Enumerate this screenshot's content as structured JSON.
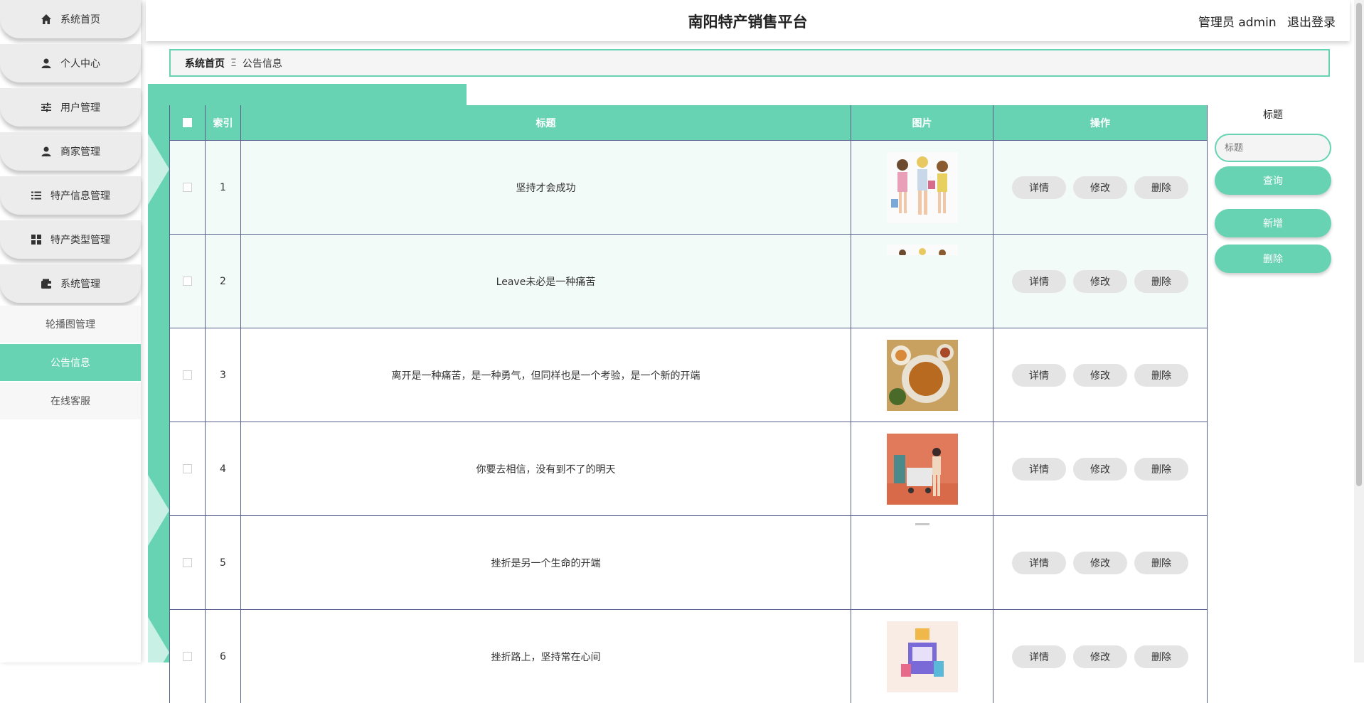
{
  "header": {
    "title": "南阳特产销售平台",
    "user_label": "管理员 admin",
    "logout_label": "退出登录"
  },
  "sidebar": {
    "menu": [
      {
        "label": "系统首页",
        "icon": "home-icon"
      },
      {
        "label": "个人中心",
        "icon": "user-icon"
      },
      {
        "label": "用户管理",
        "icon": "sliders-icon"
      },
      {
        "label": "商家管理",
        "icon": "user-icon"
      },
      {
        "label": "特产信息管理",
        "icon": "list-icon"
      },
      {
        "label": "特产类型管理",
        "icon": "grid-icon"
      },
      {
        "label": "系统管理",
        "icon": "wallet-icon"
      }
    ],
    "subitems": [
      {
        "label": "轮播图管理",
        "active": false
      },
      {
        "label": "公告信息",
        "active": true
      },
      {
        "label": "在线客服",
        "active": false
      }
    ]
  },
  "breadcrumb": {
    "home": "系统首页",
    "separator": "Ξ",
    "current": "公告信息"
  },
  "table": {
    "headers": {
      "index": "索引",
      "title": "标题",
      "picture": "图片",
      "actions": "操作"
    },
    "rows": [
      {
        "index": "1",
        "title": "坚持才会成功",
        "pic": "fashion-girls-icon"
      },
      {
        "index": "2",
        "title": "Leave未必是一种痛苦",
        "pic": "cropped-image-icon"
      },
      {
        "index": "3",
        "title": "离开是一种痛苦，是一种勇气，但同样也是一个考验，是一个新的开端",
        "pic": "food-plate-icon"
      },
      {
        "index": "4",
        "title": "你要去相信，没有到不了的明天",
        "pic": "shopping-cart-icon"
      },
      {
        "index": "5",
        "title": "挫折是另一个生命的开端",
        "pic": "cropped-image-icon"
      },
      {
        "index": "6",
        "title": "挫折路上，坚持常在心间",
        "pic": "online-shop-icon"
      }
    ],
    "actions": {
      "detail": "详情",
      "edit": "修改",
      "delete": "删除"
    }
  },
  "search": {
    "label": "标题",
    "placeholder": "标题",
    "query_button": "查询",
    "add_button": "新增",
    "delete_button": "删除"
  },
  "colors": {
    "accent": "#67d3b3",
    "border": "#56608a"
  }
}
